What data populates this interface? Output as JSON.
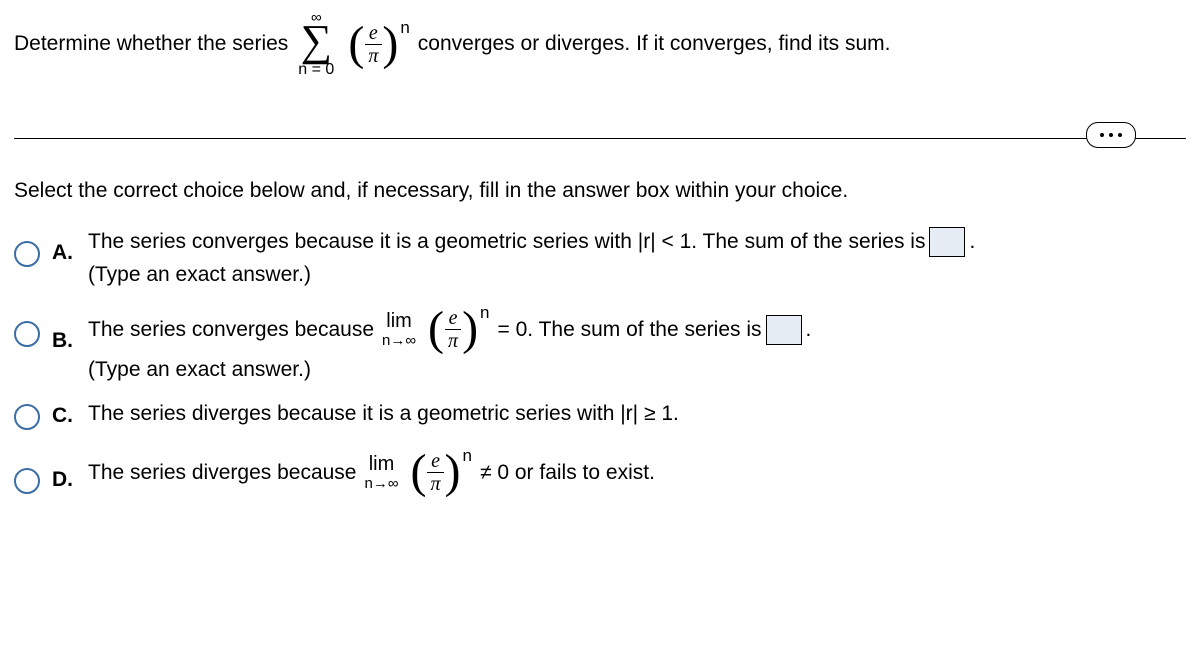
{
  "question": {
    "prefix": "Determine whether the series",
    "sum_upper": "∞",
    "sum_lower": "n = 0",
    "frac_num": "e",
    "frac_den": "π",
    "exp": "n",
    "suffix": "converges or diverges. If it converges, find its sum."
  },
  "instruction": "Select the correct choice below and, if necessary, fill in the answer box within your choice.",
  "choices": {
    "A": {
      "label": "A.",
      "text1": "The series converges because it is a geometric series with |r| < 1. The sum of the series is",
      "period": ".",
      "hint": "(Type an exact answer.)"
    },
    "B": {
      "label": "B.",
      "text1": "The series converges because",
      "lim": "lim",
      "lim_sub": "n→∞",
      "frac_num": "e",
      "frac_den": "π",
      "exp": "n",
      "text2": "= 0. The sum of the series is",
      "period": ".",
      "hint": "(Type an exact answer.)"
    },
    "C": {
      "label": "C.",
      "text": "The series diverges because it is a geometric series with |r| ≥ 1."
    },
    "D": {
      "label": "D.",
      "text1": "The series diverges because",
      "lim": "lim",
      "lim_sub": "n→∞",
      "frac_num": "e",
      "frac_den": "π",
      "exp": "n",
      "text2": "≠ 0 or fails to exist."
    }
  }
}
